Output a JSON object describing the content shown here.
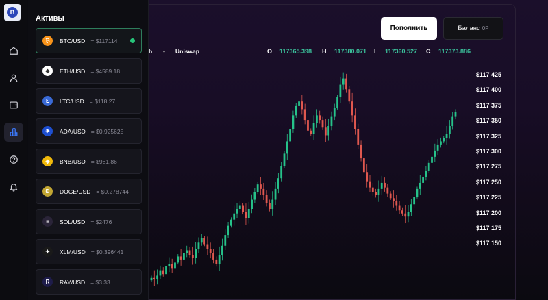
{
  "app": {
    "logo_letter": "B"
  },
  "rail": {
    "icons": [
      "home-icon",
      "user-icon",
      "wallet-icon",
      "assets-icon",
      "help-icon",
      "bell-icon"
    ],
    "active": "assets-icon"
  },
  "assets": {
    "title": "Активы",
    "items": [
      {
        "pair": "BTC/USD",
        "price": "= $117114",
        "color": "#f7931a",
        "glyph": "₿",
        "selected": true
      },
      {
        "pair": "ETH/USD",
        "price": "= $4589.18",
        "color": "#ffffff",
        "glyph": "◆"
      },
      {
        "pair": "LTC/USD",
        "price": "= $118.27",
        "color": "#3a6ad6",
        "glyph": "Ł"
      },
      {
        "pair": "ADA/USD",
        "price": "= $0.925625",
        "color": "#1e4fd0",
        "glyph": "✷"
      },
      {
        "pair": "BNB/USD",
        "price": "= $981.86",
        "color": "#f0b90b",
        "glyph": "◈"
      },
      {
        "pair": "DOGE/USD",
        "price": "= $0.278744",
        "color": "#c2a633",
        "glyph": "Ð"
      },
      {
        "pair": "SOL/USD",
        "price": "= $2476",
        "color": "#2a2438",
        "glyph": "≡"
      },
      {
        "pair": "XLM/USD",
        "price": "= $0.396441",
        "color": "#1a1a1a",
        "glyph": "✦"
      },
      {
        "pair": "RAY/USD",
        "price": "= $3.33",
        "color": "#1e1c4a",
        "glyph": "R"
      }
    ]
  },
  "toolbar": {
    "deposit_label": "Пополнить",
    "balance_label": "Баланс",
    "balance_value": "0P"
  },
  "ohlc": {
    "interval": "h",
    "source": "Uniswap",
    "o_label": "O",
    "o_value": "117365.398",
    "h_label": "H",
    "h_value": "117380.071",
    "l_label": "L",
    "l_value": "117360.527",
    "c_label": "C",
    "c_value": "117373.886"
  },
  "chart_data": {
    "type": "candlestick",
    "y_ticks": [
      "$117 425",
      "$117 400",
      "$117 375",
      "$117 350",
      "$117 325",
      "$117 300",
      "$117 275",
      "$117 250",
      "$117 225",
      "$117 200",
      "$117 175",
      "$117 150"
    ],
    "ylim": [
      117150,
      117425
    ],
    "up_color": "#26c28a",
    "down_color": "#e0584f",
    "closes": [
      117160,
      117158,
      117163,
      117170,
      117165,
      117175,
      117178,
      117172,
      117180,
      117188,
      117184,
      117192,
      117196,
      117190,
      117186,
      117198,
      117206,
      117212,
      117204,
      117198,
      117192,
      117184,
      117178,
      117190,
      117202,
      117216,
      117228,
      117236,
      117244,
      117250,
      117254,
      117246,
      117238,
      117250,
      117262,
      117272,
      117282,
      117276,
      117268,
      117258,
      117250,
      117262,
      117276,
      117290,
      117306,
      117322,
      117338,
      117354,
      117372,
      117384,
      117390,
      117380,
      117366,
      117352,
      117348,
      117362,
      117372,
      117366,
      117356,
      117346,
      117358,
      117370,
      117382,
      117396,
      117412,
      117420,
      117406,
      117390,
      117372,
      117354,
      117334,
      117316,
      117298,
      117286,
      117278,
      117272,
      117268,
      117276,
      117284,
      117278,
      117270,
      117264,
      117260,
      117254,
      117248,
      117244,
      117240,
      117246,
      117256,
      117266,
      117276,
      117284,
      117292,
      117300,
      117310,
      117318,
      117326,
      117334,
      117338,
      117342,
      117348,
      117358,
      117370,
      117376
    ]
  }
}
